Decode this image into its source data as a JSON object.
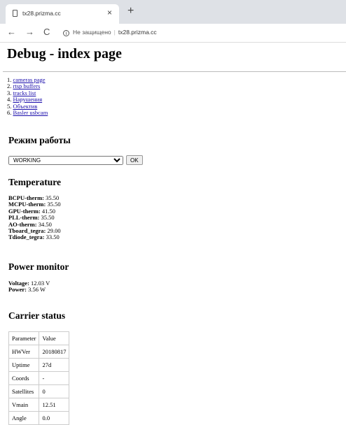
{
  "browser": {
    "tab_title": "tx28.prizma.cc",
    "tab_close": "×",
    "new_tab": "+",
    "nav": {
      "back": "←",
      "forward": "→",
      "reload": "C"
    },
    "info_icon": "i",
    "insecure_label": "Не защищено",
    "separator": "|",
    "url": "tx28.prizma.cc"
  },
  "page": {
    "title": "Debug - index page",
    "links": [
      {
        "num": "1.",
        "label": "cameras page"
      },
      {
        "num": "2.",
        "label": "rtsp buffers"
      },
      {
        "num": "3.",
        "label": "tracks list"
      },
      {
        "num": "4.",
        "label": "Нарушения"
      },
      {
        "num": "5.",
        "label": "Объектив"
      },
      {
        "num": "6.",
        "label": "Basler usbcam"
      }
    ],
    "mode": {
      "heading": "Режим работы",
      "selected": "WORKING",
      "ok_label": "OK"
    },
    "temperature": {
      "heading": "Temperature",
      "items": [
        {
          "label": "BCPU-therm:",
          "value": "35.50"
        },
        {
          "label": "MCPU-therm:",
          "value": "35.50"
        },
        {
          "label": "GPU-therm:",
          "value": "41.50"
        },
        {
          "label": "PLL-therm:",
          "value": "35.50"
        },
        {
          "label": "AO-therm:",
          "value": "34.50"
        },
        {
          "label": "Tboard_tegra:",
          "value": "29.00"
        },
        {
          "label": "Tdiode_tegra:",
          "value": "33.50"
        }
      ]
    },
    "power": {
      "heading": "Power monitor",
      "items": [
        {
          "label": "Voltage:",
          "value": "12.03 V"
        },
        {
          "label": "Power:",
          "value": "3.56 W"
        }
      ]
    },
    "carrier": {
      "heading": "Carrier status",
      "columns": [
        "Parameter",
        "Value"
      ],
      "rows": [
        [
          "HWVer",
          "20180817"
        ],
        [
          "Uptime",
          "27d"
        ],
        [
          "Coords",
          "-"
        ],
        [
          "Satellites",
          "0"
        ],
        [
          "Vmain",
          "12.51"
        ],
        [
          "Angle",
          "0.0"
        ]
      ]
    }
  }
}
